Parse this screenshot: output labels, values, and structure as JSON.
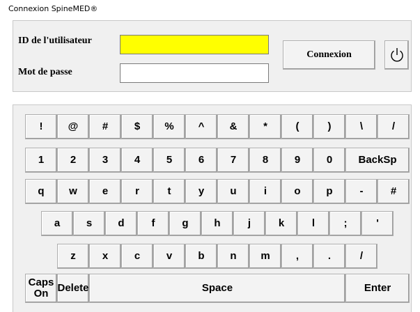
{
  "window": {
    "title": "Connexion SpineMED®"
  },
  "login": {
    "user_label": "ID de l'utilisateur",
    "user_value": "",
    "password_label": "Mot de passe",
    "password_value": "",
    "connect_label": "Connexion",
    "power_icon": "power-icon",
    "colors": {
      "user_field_bg": "#ffff00"
    }
  },
  "keyboard": {
    "row1": [
      "!",
      "@",
      "#",
      "$",
      "%",
      "^",
      "&",
      "*",
      "(",
      ")",
      "\\",
      "/"
    ],
    "row2": [
      "1",
      "2",
      "3",
      "4",
      "5",
      "6",
      "7",
      "8",
      "9",
      "0",
      "BackSp"
    ],
    "row3": [
      "q",
      "w",
      "e",
      "r",
      "t",
      "y",
      "u",
      "i",
      "o",
      "p",
      "-",
      "#"
    ],
    "row4": [
      "a",
      "s",
      "d",
      "f",
      "g",
      "h",
      "j",
      "k",
      "l",
      ";",
      "'"
    ],
    "row5": [
      "z",
      "x",
      "c",
      "v",
      "b",
      "n",
      "m",
      ",",
      ".",
      "/"
    ],
    "row6": [
      "Caps\nOn",
      "Delete",
      "Space",
      "Enter"
    ]
  }
}
